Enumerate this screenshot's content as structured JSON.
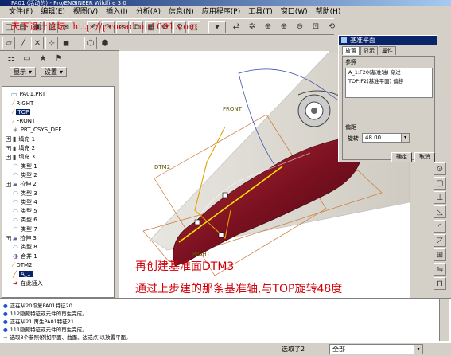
{
  "window": {
    "title": "PA01 (活动的) - Pro/ENGINEER Wildfire 3.0"
  },
  "menu": [
    "文件(F)",
    "编辑(E)",
    "视图(V)",
    "插入(I)",
    "分析(A)",
    "信息(N)",
    "应用程序(P)",
    "工具(T)",
    "窗口(W)",
    "帮助(H)"
  ],
  "watermark": "天下设计论坛: http://procad.uu1001.com",
  "tree_controls": {
    "show": "显示",
    "settings": "设置"
  },
  "tree": [
    {
      "label": "PA01.PRT",
      "depth": 0,
      "icon": "part"
    },
    {
      "label": "RIGHT",
      "depth": 1,
      "icon": "plane"
    },
    {
      "label": "TOP",
      "depth": 1,
      "icon": "plane",
      "selected": true
    },
    {
      "label": "FRONT",
      "depth": 1,
      "icon": "plane"
    },
    {
      "label": "PRT_CSYS_DEF",
      "depth": 1,
      "icon": "csys"
    },
    {
      "label": "填充 1",
      "depth": 1,
      "icon": "fill",
      "expand": "+"
    },
    {
      "label": "填充 2",
      "depth": 1,
      "icon": "fill",
      "expand": "+"
    },
    {
      "label": "填充 3",
      "depth": 1,
      "icon": "fill",
      "expand": "+"
    },
    {
      "label": "类型 1",
      "depth": 1,
      "icon": "surf"
    },
    {
      "label": "类型 2",
      "depth": 1,
      "icon": "surf"
    },
    {
      "label": "拉伸 2",
      "depth": 1,
      "icon": "extrude",
      "expand": "+"
    },
    {
      "label": "类型 3",
      "depth": 1,
      "icon": "surf"
    },
    {
      "label": "类型 4",
      "depth": 1,
      "icon": "surf"
    },
    {
      "label": "类型 5",
      "depth": 1,
      "icon": "surf"
    },
    {
      "label": "类型 6",
      "depth": 1,
      "icon": "surf"
    },
    {
      "label": "类型 7",
      "depth": 1,
      "icon": "surf"
    },
    {
      "label": "拉伸 3",
      "depth": 1,
      "icon": "extrude",
      "expand": "+"
    },
    {
      "label": "类型 8",
      "depth": 1,
      "icon": "surf"
    },
    {
      "label": "合并 1",
      "depth": 1,
      "icon": "merge"
    },
    {
      "label": "DTM2",
      "depth": 1,
      "icon": "plane"
    },
    {
      "label": "A_1",
      "depth": 1,
      "icon": "axis",
      "selected": true
    },
    {
      "label": "在此插入",
      "depth": 1,
      "icon": "insert"
    }
  ],
  "dialog": {
    "title": "基准平面",
    "tabs": [
      "放置",
      "显示",
      "属性"
    ],
    "ref_label": "参照",
    "refs": [
      "A_1:F20(基准轴)  穿过",
      "TOP:F2(基准平面)  偏移"
    ],
    "offset_label": "偏距",
    "rotate_label": "旋转",
    "rotate_value": "48.00",
    "ok": "确定",
    "cancel": "取消"
  },
  "viewport_labels": {
    "front": "FRONT",
    "dtm2": "DTM2",
    "right": "RIGHT"
  },
  "captions": [
    "再创建基准面DTM3",
    "通过上步建的那条基准轴,与TOP旋转48度"
  ],
  "messages": [
    "正在从20恢复PA01特征20 ...",
    "112隐藏特征或元件的再生完成。",
    "正在从21 再生PA01特征21 ...",
    "111隐藏特征或元件的再生完成。",
    "选取3个参照(例如平面、曲面、边或点)以放置平面。"
  ],
  "statusbar": {
    "selected": "选取了2",
    "filter": "全部"
  },
  "colors": {
    "accent": "#0a246a",
    "car_body": "#7a1020",
    "annotation": "#d2000a"
  }
}
